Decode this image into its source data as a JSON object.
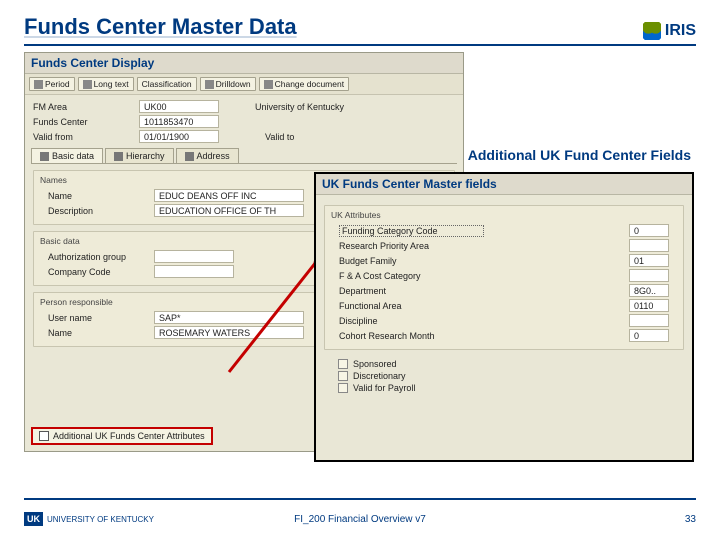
{
  "title": "Funds Center Master Data",
  "logo_text": "IRIS",
  "callout": "Additional UK Fund Center Fields",
  "win1": {
    "title": "Funds Center Display",
    "toolbar": [
      {
        "label": "Period"
      },
      {
        "label": "Long text"
      },
      {
        "label": "Classification"
      },
      {
        "label": "Drilldown"
      },
      {
        "label": "Change document"
      }
    ],
    "header": {
      "fm_area_lbl": "FM Area",
      "fm_area_val": "UK00",
      "fm_area_desc": "University of Kentucky",
      "fc_lbl": "Funds Center",
      "fc_val": "1011853470",
      "valid_from_lbl": "Valid from",
      "valid_from_val": "01/01/1900",
      "valid_to_lbl": "Valid to"
    },
    "tabs": [
      "Basic data",
      "Hierarchy",
      "Address"
    ],
    "names_group": "Names",
    "name_lbl": "Name",
    "name_val": "EDUC DEANS OFF INC",
    "desc_lbl": "Description",
    "desc_val": "EDUCATION OFFICE OF TH",
    "basic_group": "Basic data",
    "auth_lbl": "Authorization group",
    "company_lbl": "Company Code",
    "person_group": "Person responsible",
    "user_lbl": "User name",
    "user_val": "SAP*",
    "pname_lbl": "Name",
    "pname_val": "ROSEMARY WATERS",
    "addl_btn": "Additional UK Funds Center Attributes"
  },
  "win2": {
    "title": "UK Funds Center Master fields",
    "group": "UK Attributes",
    "rows": [
      {
        "label": "Funding Category Code",
        "value": "0"
      },
      {
        "label": "Research Priority Area",
        "value": ""
      },
      {
        "label": "Budget Family",
        "value": "01"
      },
      {
        "label": "F & A Cost Category",
        "value": ""
      },
      {
        "label": "Department",
        "value": "8G0.."
      },
      {
        "label": "Functional Area",
        "value": "0110"
      },
      {
        "label": "Discipline",
        "value": ""
      },
      {
        "label": "Cohort Research Month",
        "value": "0"
      }
    ],
    "checks": [
      "Sponsored",
      "Discretionary",
      "Valid for Payroll"
    ]
  },
  "footer": {
    "org": "UNIVERSITY OF KENTUCKY",
    "center": "FI_200 Financial Overview v7",
    "page": "33"
  }
}
